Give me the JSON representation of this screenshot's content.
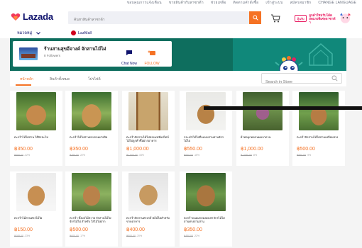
{
  "topbar": {
    "links": [
      "ขอบคุณการแจ้งเตือน",
      "ขายสินค้ากับลาซาด้า",
      "ช่วยเหลือ",
      "ติดตามคำสั่งซื้อ",
      "เข้าสู่ระบบ",
      "สมัครสมาชิก",
      "CHANGE LANGUAGE"
    ]
  },
  "header": {
    "logo_text": "Lazada",
    "search_placeholder": "ค้นหาสินค้าลาซาด้า",
    "promo_badge": "ลุ้นรับ",
    "promo_text_1": "ลูกค้าใหม่รับโค้ด",
    "promo_text_2": "ลดแรงพิเศษลาซาด้า"
  },
  "nav": {
    "category_label": "หมวดหมู่",
    "lazmall_label": "LazMall"
  },
  "store": {
    "name": "ร้านสานสุขอีจางค์ จักสานไม้ไผ่",
    "followers": "8 Followers",
    "chat_label": "Chat Now",
    "follow_label": "FOLLOW"
  },
  "tabs": {
    "items": [
      "หน้าหลัก",
      "สินค้าทั้งหมด",
      "โปรไฟล์"
    ],
    "active_index": 0,
    "search_placeholder": "Search in Store"
  },
  "colors": {
    "accent": "#f57224",
    "brand_dark": "#0f136d",
    "banner": "#0e6e5e"
  },
  "products": [
    {
      "title": "ตะกร้าไม้ไผ่สาน ไส้ผักชะไม่",
      "price": "฿350.00",
      "old_price": "฿450.00",
      "discount": "-22%"
    },
    {
      "title": "ตะกร้าไม้ไผ่สานทรงกลมฝาเปิด",
      "price": "฿350.00",
      "old_price": "฿450.00",
      "discount": "-22%"
    },
    {
      "title": "ตะกร้าจักสานไม้ไผ่ทรงแฟชั่นสไตล์ไม้ไผ่ลูกค้าซื้อฝากอาหาร",
      "price": "฿1,000.00",
      "old_price": "฿1,500.00",
      "discount": "-33%"
    },
    {
      "title": "กระเป๋าไม้ไผ่ถือแบบสานย่านจักรไม้ไผ่",
      "price": "฿550.00",
      "old_price": "฿650.00",
      "discount": "-15%"
    },
    {
      "title": "ผ้าทอมุกคอกนมคลาดาน",
      "price": "฿1,000.00",
      "old_price": "฿1,090.00",
      "discount": "-8%"
    },
    {
      "title": "ตะกร้าจักสานไม้ไผ่สามเหลือบทรง",
      "price": "฿500.00",
      "old_price": "฿550.00",
      "discount": "-9%"
    },
    {
      "title": "ตะกร้าไม้สานทรงไม้ไผ่",
      "price": "฿150.00",
      "old_price": "฿195.00",
      "discount": "-23%"
    },
    {
      "title": "ตะกร้า ทั้งผลไม้หวาย จักสานไม้ไผ่ จักรไม้ไผ่ สำหรับ ใส่ไม้ไผ่ฝาก ",
      "price": "฿500.00",
      "old_price": "฿600.00",
      "discount": "-17%"
    },
    {
      "title": "ตะกร้าจักสานทรงกล้วยไม้ไผ่สำหรับขาดอาหาร",
      "price": "฿400.00",
      "old_price": "฿500.00",
      "discount": "-20%"
    },
    {
      "title": "ตะกร้าถนอมกล่องอดงท่ จักรไม้ไผ่สานทรงสามสาน",
      "price": "฿350.00",
      "old_price": "฿450.00",
      "discount": "-22%"
    }
  ]
}
